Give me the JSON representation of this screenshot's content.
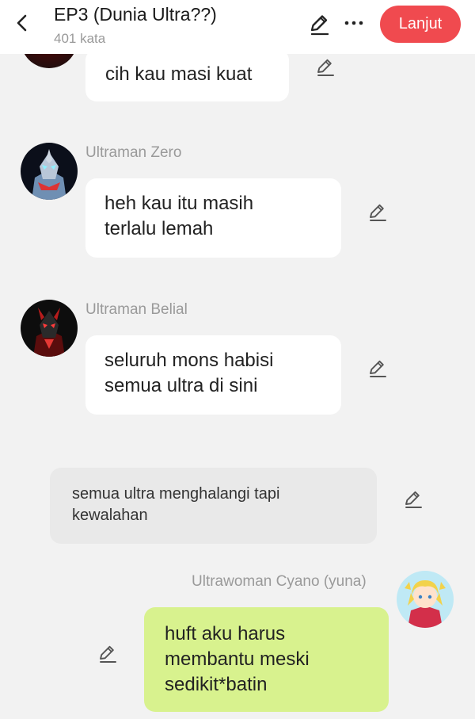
{
  "header": {
    "title": "EP3 (Dunia Ultra??)",
    "word_count": "401 kata",
    "next_label": "Lanjut",
    "accent": "#f04a4f"
  },
  "messages": [
    {
      "sender": "",
      "lines": [
        "cih kau masi kuat"
      ]
    },
    {
      "sender": "Ultraman Zero",
      "avatar": "ultraman-zero-avatar",
      "lines": [
        "heh kau itu masih",
        "terlalu lemah"
      ]
    },
    {
      "sender": "Ultraman Belial",
      "avatar": "ultraman-belial-avatar",
      "lines": [
        "seluruh mons habisi",
        "semua ultra di sini"
      ]
    },
    {
      "type": "narration",
      "lines": [
        "semua ultra menghalangi tapi",
        "kewalahan"
      ]
    },
    {
      "sender": "Ultrawoman Cyano (yuna)",
      "avatar": "ultrawoman-cyano-avatar",
      "lines": [
        "huft aku harus",
        "membantu meski",
        "sedikit*batin"
      ],
      "bubble_color": "#d8f28e"
    }
  ]
}
